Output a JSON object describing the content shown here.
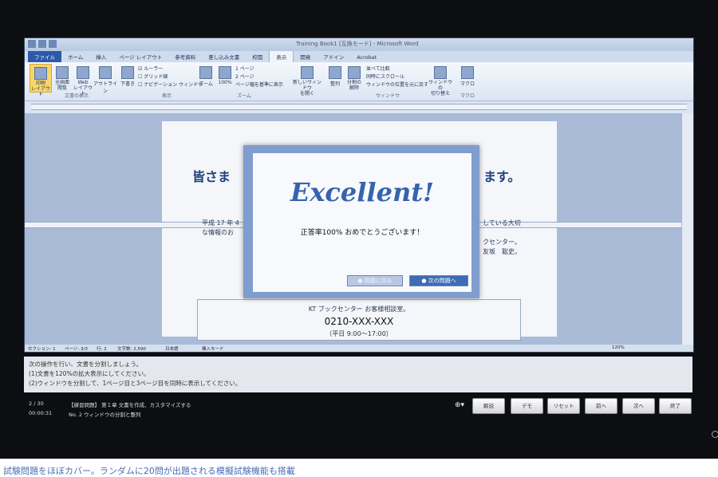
{
  "window": {
    "title": "Training Book1 [互換モード] - Microsoft Word"
  },
  "tabs": [
    "ファイル",
    "ホーム",
    "挿入",
    "ページ レイアウト",
    "参考資料",
    "差し込み文書",
    "校閲",
    "表示",
    "開発",
    "アドイン",
    "Acrobat"
  ],
  "ribbon": {
    "print_layout": "印刷\nレイアウト",
    "full_screen": "全画面\n閲覧",
    "web_layout": "Web\nレイアウト",
    "outline": "アウトライン",
    "draft": "下書き",
    "group_views": "文書の表示",
    "ruler": "ルーラー",
    "gridlines": "グリッド線",
    "nav_pane": "ナビゲーション ウィンドウ",
    "group_show": "表示",
    "zoom": "ズーム",
    "zoom100": "100%",
    "one_page": "1 ページ",
    "two_pages": "2 ページ",
    "page_width": "ページ幅を基準に表示",
    "group_zoom": "ズーム",
    "new_window": "新しいウィンドウ\nを開く",
    "arrange": "整列",
    "split": "分割の\n解除",
    "side_by_side": "並べて比較",
    "sync_scroll": "同時にスクロール",
    "reset_pos": "ウィンドウの位置を元に戻す",
    "switch_windows": "ウィンドウの\n切り替え",
    "group_window": "ウィンドウ",
    "macros": "マクロ",
    "group_macros": "マクロ"
  },
  "document": {
    "heading_left": "皆さま",
    "heading_right": "ます。",
    "text_left_1": "平成 17 年 4",
    "text_left_2": "な情報のお",
    "text_right_1": "している大切",
    "text_right_2": "クセンター。",
    "text_right_3": "友坂　聡史。",
    "contact_line1": "KT ブックセンター お客様相談室。",
    "contact_line2": "0210-XXX-XXX",
    "contact_line3": "（平日 9:00〜17:00）"
  },
  "dialog": {
    "title": "Excellent!",
    "message": "正答率100% おめでとうございます！",
    "back_button": "問題に戻る",
    "next_button": "次の問題へ"
  },
  "statusbar": {
    "section": "セクション: 1",
    "page": "ページ: 3/3",
    "line": "行: 2",
    "words": "文字数: 2,590",
    "language": "日本語",
    "mode": "挿入モード",
    "zoom": "120%"
  },
  "task": {
    "line1": "次の操作を行い、文書を分割しましょう。",
    "line2": "(1)文書を120%の拡大表示にしてください。",
    "line3": "(2)ウィンドウを分割して、1ページ目と3ページ目を同時に表示してください。"
  },
  "controls": {
    "progress": "2 / 30",
    "timer": "00:00:31",
    "category": "【練習問題】 第１章 文書を作成、カスタマイズする",
    "question": "No. 2 ウィンドウの分割と整列",
    "buttons": [
      "解説",
      "デモ",
      "リセット",
      "前へ",
      "次へ",
      "終了"
    ]
  },
  "caption": "試験問題をほぼカバー。ランダムに20問が出題される模擬試験機能も搭載"
}
